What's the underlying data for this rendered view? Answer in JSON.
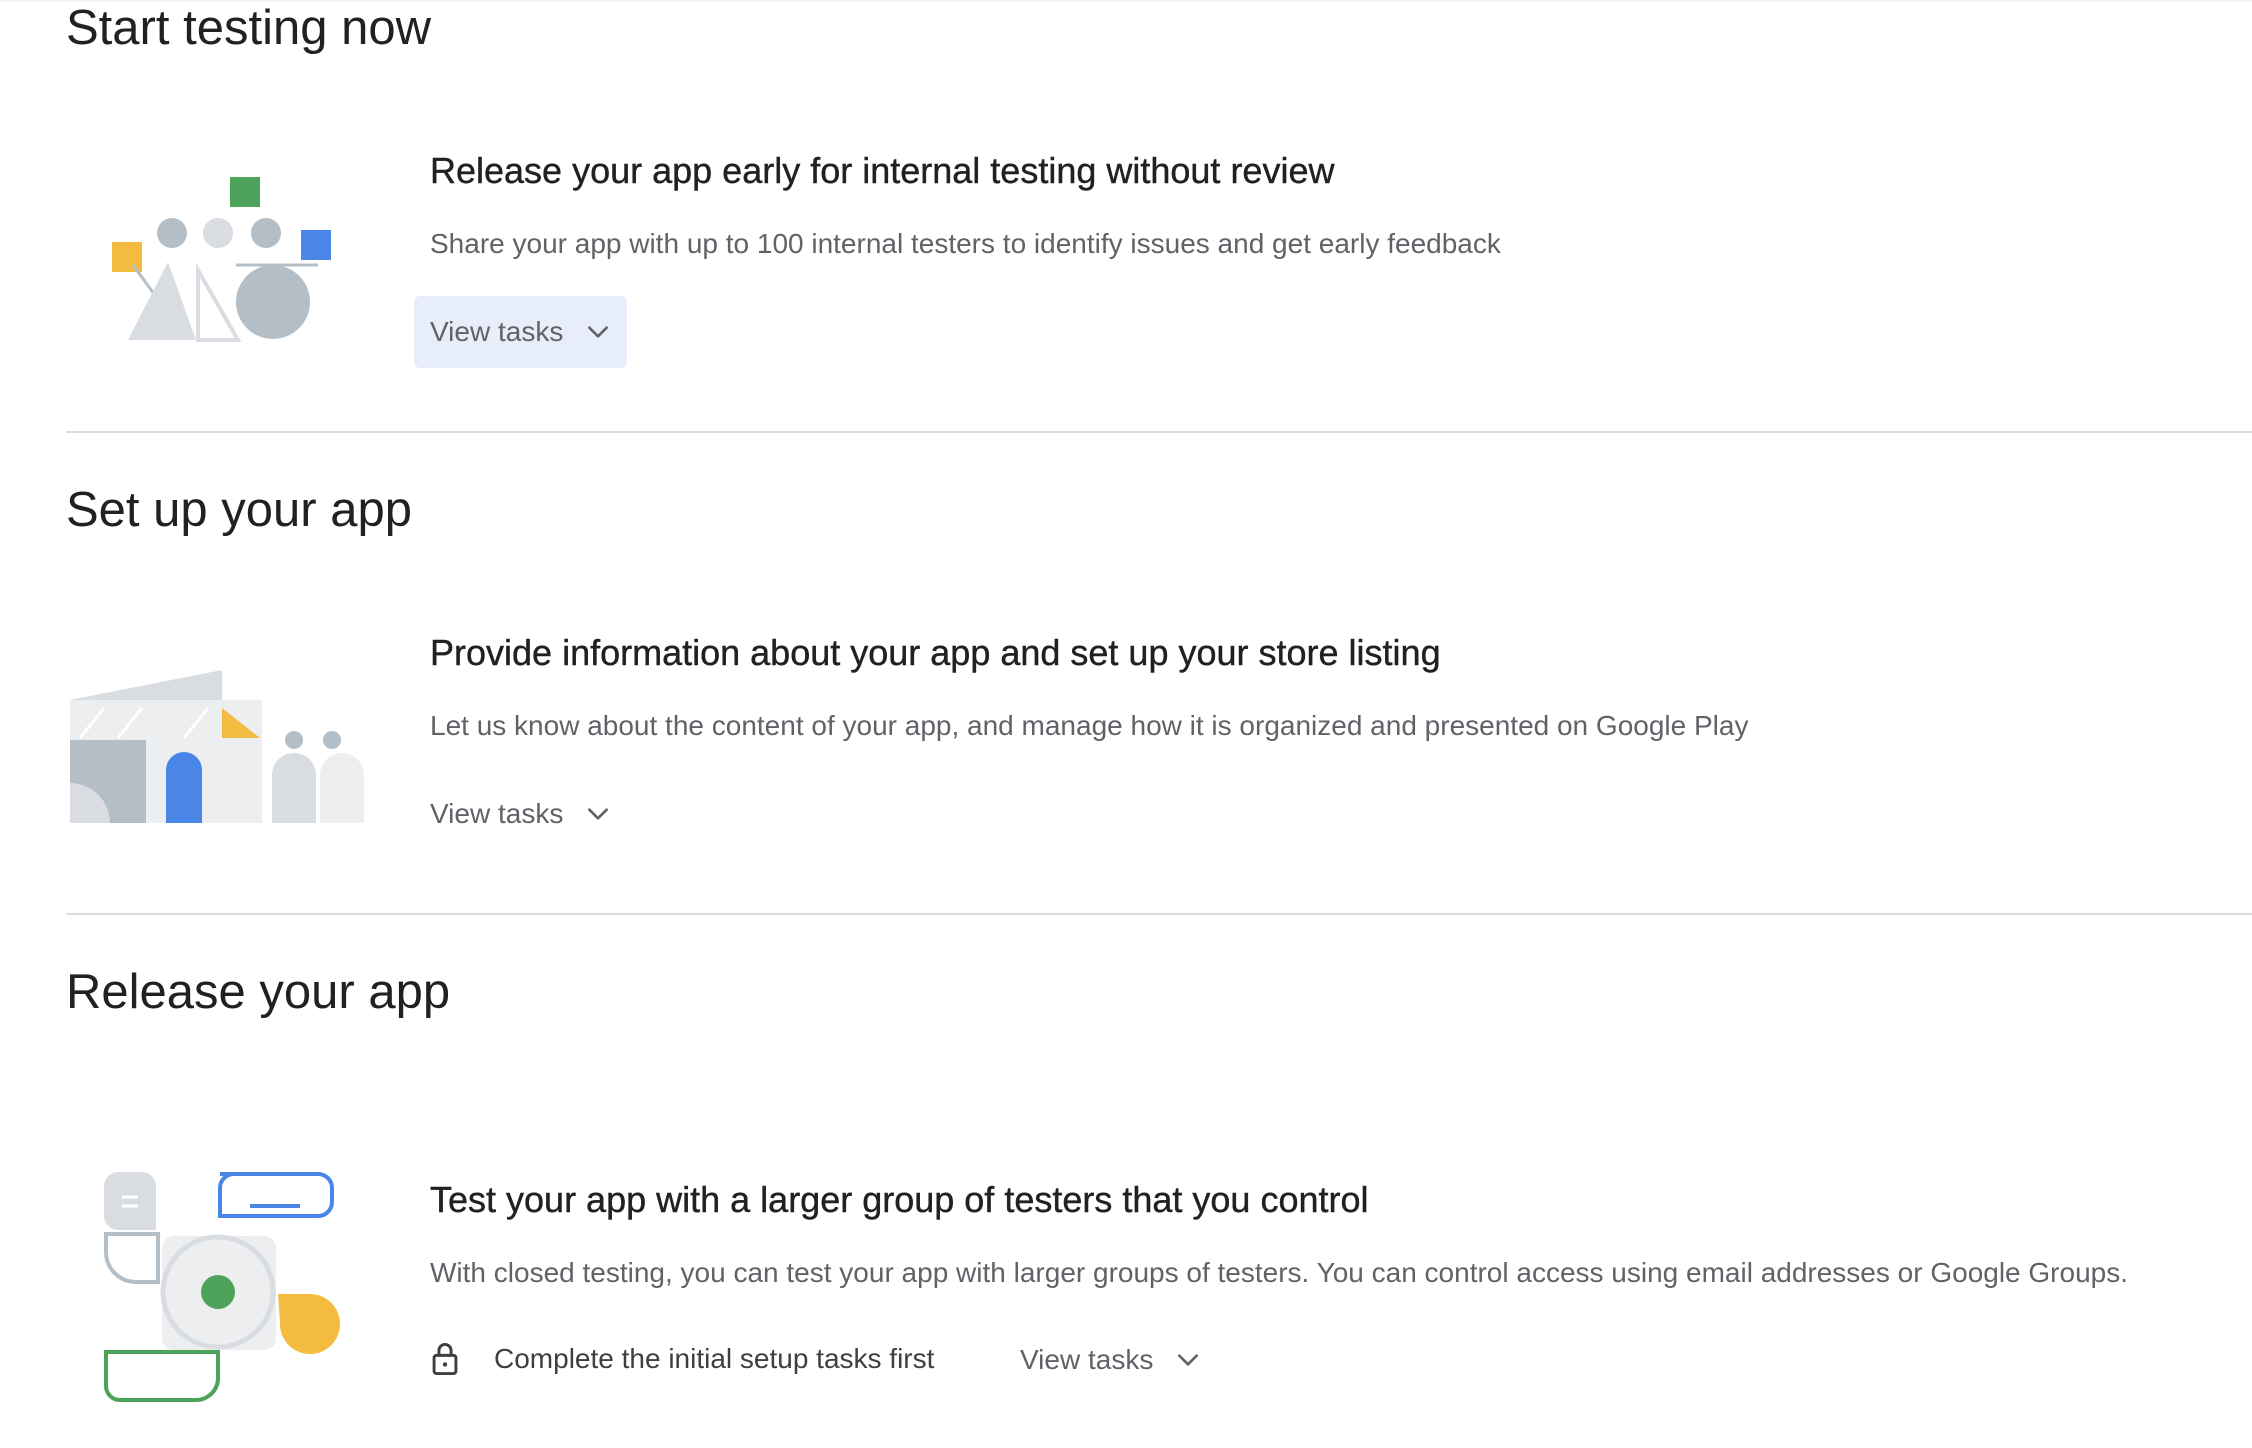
{
  "sections": [
    {
      "title": "Start testing now",
      "card": {
        "title": "Release your app early for internal testing without review",
        "description": "Share your app with up to 100 internal testers to identify issues and get early feedback",
        "view_tasks_label": "View tasks"
      }
    },
    {
      "title": "Set up your app",
      "card": {
        "title": "Provide information about your app and set up your store listing",
        "description": "Let us know about the content of your app, and manage how it is organized and presented on Google Play",
        "view_tasks_label": "View tasks"
      }
    },
    {
      "title": "Release your app",
      "card": {
        "title": "Test your app with a larger group of testers that you control",
        "description": "With closed testing, you can test your app with larger groups of testers. You can control access using email addresses or Google Groups.",
        "locked_message": "Complete the initial setup tasks first",
        "view_tasks_label": "View tasks"
      }
    }
  ],
  "colors": {
    "green": "#4ea35b",
    "blue": "#4a86e8",
    "yellow": "#f4bb41",
    "gray": "#b4bec6",
    "light_gray": "#d9dde1",
    "active_button_bg": "#e8eef9"
  },
  "icons": {
    "chevron": "chevron-down-icon",
    "lock": "lock-icon"
  }
}
